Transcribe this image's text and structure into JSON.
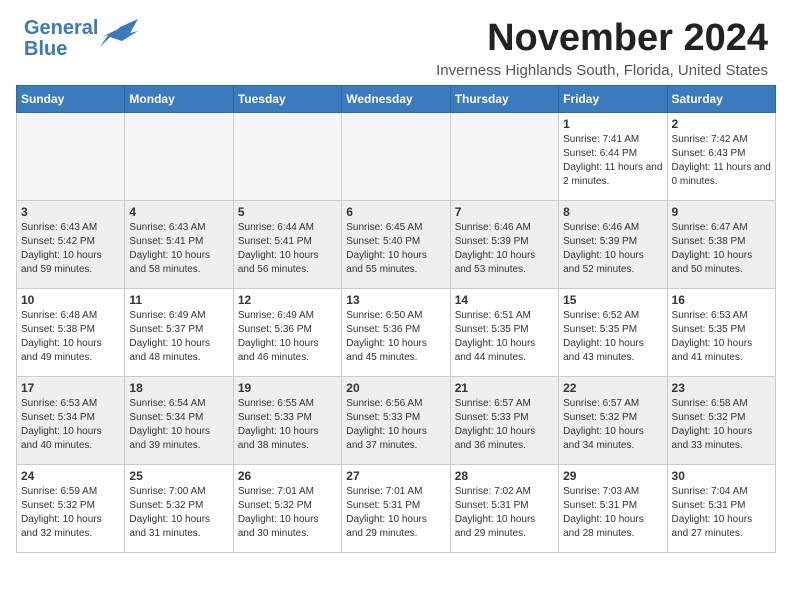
{
  "header": {
    "logo_line1": "General",
    "logo_line2": "Blue",
    "month_title": "November 2024",
    "location": "Inverness Highlands South, Florida, United States"
  },
  "days_of_week": [
    "Sunday",
    "Monday",
    "Tuesday",
    "Wednesday",
    "Thursday",
    "Friday",
    "Saturday"
  ],
  "weeks": [
    [
      {
        "day": "",
        "empty": true
      },
      {
        "day": "",
        "empty": true
      },
      {
        "day": "",
        "empty": true
      },
      {
        "day": "",
        "empty": true
      },
      {
        "day": "",
        "empty": true
      },
      {
        "day": "1",
        "sunrise": "7:41 AM",
        "sunset": "6:44 PM",
        "daylight": "11 hours and 2 minutes."
      },
      {
        "day": "2",
        "sunrise": "7:42 AM",
        "sunset": "6:43 PM",
        "daylight": "11 hours and 0 minutes."
      }
    ],
    [
      {
        "day": "3",
        "sunrise": "6:43 AM",
        "sunset": "5:42 PM",
        "daylight": "10 hours and 59 minutes."
      },
      {
        "day": "4",
        "sunrise": "6:43 AM",
        "sunset": "5:41 PM",
        "daylight": "10 hours and 58 minutes."
      },
      {
        "day": "5",
        "sunrise": "6:44 AM",
        "sunset": "5:41 PM",
        "daylight": "10 hours and 56 minutes."
      },
      {
        "day": "6",
        "sunrise": "6:45 AM",
        "sunset": "5:40 PM",
        "daylight": "10 hours and 55 minutes."
      },
      {
        "day": "7",
        "sunrise": "6:46 AM",
        "sunset": "5:39 PM",
        "daylight": "10 hours and 53 minutes."
      },
      {
        "day": "8",
        "sunrise": "6:46 AM",
        "sunset": "5:39 PM",
        "daylight": "10 hours and 52 minutes."
      },
      {
        "day": "9",
        "sunrise": "6:47 AM",
        "sunset": "5:38 PM",
        "daylight": "10 hours and 50 minutes."
      }
    ],
    [
      {
        "day": "10",
        "sunrise": "6:48 AM",
        "sunset": "5:38 PM",
        "daylight": "10 hours and 49 minutes."
      },
      {
        "day": "11",
        "sunrise": "6:49 AM",
        "sunset": "5:37 PM",
        "daylight": "10 hours and 48 minutes."
      },
      {
        "day": "12",
        "sunrise": "6:49 AM",
        "sunset": "5:36 PM",
        "daylight": "10 hours and 46 minutes."
      },
      {
        "day": "13",
        "sunrise": "6:50 AM",
        "sunset": "5:36 PM",
        "daylight": "10 hours and 45 minutes."
      },
      {
        "day": "14",
        "sunrise": "6:51 AM",
        "sunset": "5:35 PM",
        "daylight": "10 hours and 44 minutes."
      },
      {
        "day": "15",
        "sunrise": "6:52 AM",
        "sunset": "5:35 PM",
        "daylight": "10 hours and 43 minutes."
      },
      {
        "day": "16",
        "sunrise": "6:53 AM",
        "sunset": "5:35 PM",
        "daylight": "10 hours and 41 minutes."
      }
    ],
    [
      {
        "day": "17",
        "sunrise": "6:53 AM",
        "sunset": "5:34 PM",
        "daylight": "10 hours and 40 minutes."
      },
      {
        "day": "18",
        "sunrise": "6:54 AM",
        "sunset": "5:34 PM",
        "daylight": "10 hours and 39 minutes."
      },
      {
        "day": "19",
        "sunrise": "6:55 AM",
        "sunset": "5:33 PM",
        "daylight": "10 hours and 38 minutes."
      },
      {
        "day": "20",
        "sunrise": "6:56 AM",
        "sunset": "5:33 PM",
        "daylight": "10 hours and 37 minutes."
      },
      {
        "day": "21",
        "sunrise": "6:57 AM",
        "sunset": "5:33 PM",
        "daylight": "10 hours and 36 minutes."
      },
      {
        "day": "22",
        "sunrise": "6:57 AM",
        "sunset": "5:32 PM",
        "daylight": "10 hours and 34 minutes."
      },
      {
        "day": "23",
        "sunrise": "6:58 AM",
        "sunset": "5:32 PM",
        "daylight": "10 hours and 33 minutes."
      }
    ],
    [
      {
        "day": "24",
        "sunrise": "6:59 AM",
        "sunset": "5:32 PM",
        "daylight": "10 hours and 32 minutes."
      },
      {
        "day": "25",
        "sunrise": "7:00 AM",
        "sunset": "5:32 PM",
        "daylight": "10 hours and 31 minutes."
      },
      {
        "day": "26",
        "sunrise": "7:01 AM",
        "sunset": "5:32 PM",
        "daylight": "10 hours and 30 minutes."
      },
      {
        "day": "27",
        "sunrise": "7:01 AM",
        "sunset": "5:31 PM",
        "daylight": "10 hours and 29 minutes."
      },
      {
        "day": "28",
        "sunrise": "7:02 AM",
        "sunset": "5:31 PM",
        "daylight": "10 hours and 29 minutes."
      },
      {
        "day": "29",
        "sunrise": "7:03 AM",
        "sunset": "5:31 PM",
        "daylight": "10 hours and 28 minutes."
      },
      {
        "day": "30",
        "sunrise": "7:04 AM",
        "sunset": "5:31 PM",
        "daylight": "10 hours and 27 minutes."
      }
    ]
  ],
  "labels": {
    "sunrise": "Sunrise:",
    "sunset": "Sunset:",
    "daylight": "Daylight:"
  }
}
